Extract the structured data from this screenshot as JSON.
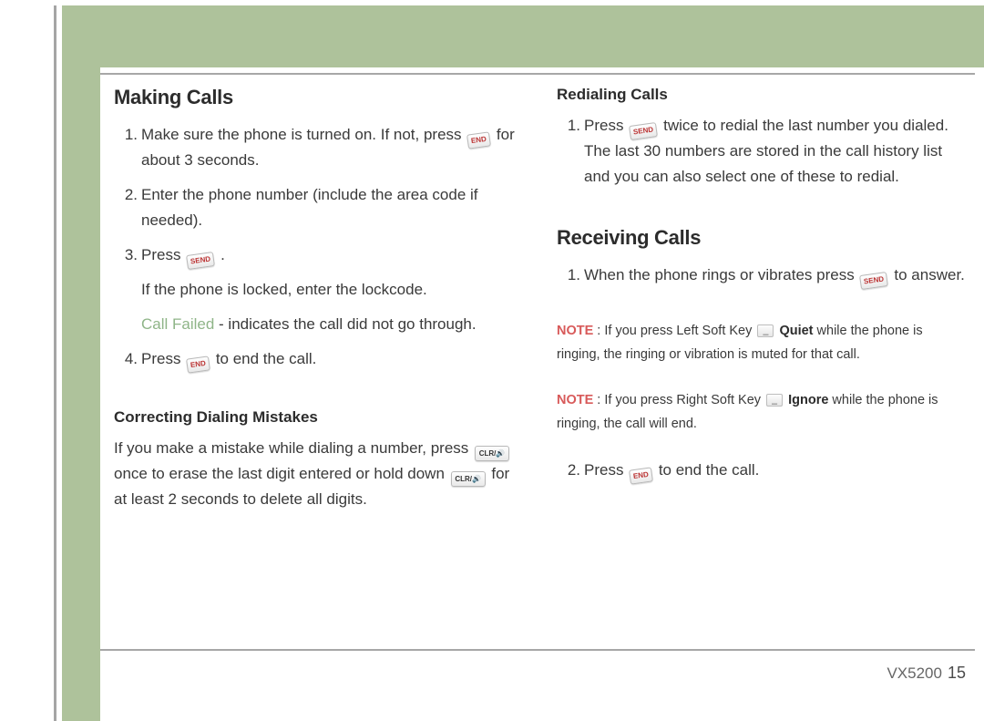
{
  "left_column": {
    "h1": "Making Calls",
    "li1_a": "Make sure the phone is turned on. If not, press ",
    "li1_b": " for about 3 seconds.",
    "li2": "Enter the phone number (include the area code if needed).",
    "li3_a": "Press ",
    "li3_b": " .",
    "locked_line": "If the phone is locked, enter the lockcode.",
    "call_failed_label": "Call Failed",
    "call_failed_rest": " - indicates the call did not go through.",
    "li4_a": "Press ",
    "li4_b": " to end the call.",
    "h2": "Correcting Dialing Mistakes",
    "p1_a": "If you make a mistake while dialing a number, press ",
    "p1_b": " once to erase the last digit entered or hold down ",
    "p1_c": " for at least 2 seconds to delete all digits."
  },
  "right_column": {
    "h2a": "Redialing Calls",
    "r1_a": "Press ",
    "r1_b": " twice to redial the last number you dialed. The last 30 numbers are stored in the call history list and you can also select one of these to redial.",
    "h1b": "Receiving Calls",
    "rc1_a": "When the phone rings or vibrates press ",
    "rc1_b": " to answer.",
    "note_label": "NOTE",
    "note1_a": " : If you press Left Soft Key ",
    "note1_b_bold": "Quiet",
    "note1_c": " while the phone is ringing, the ringing or vibration is muted for that call.",
    "note2_a": " : If you press Right Soft Key ",
    "note2_b_bold": "Ignore",
    "note2_c": " while the phone is ringing,  the call will end.",
    "rc2_a": "Press ",
    "rc2_b": " to end the call."
  },
  "footer": {
    "model": "VX5200",
    "page": "15"
  }
}
